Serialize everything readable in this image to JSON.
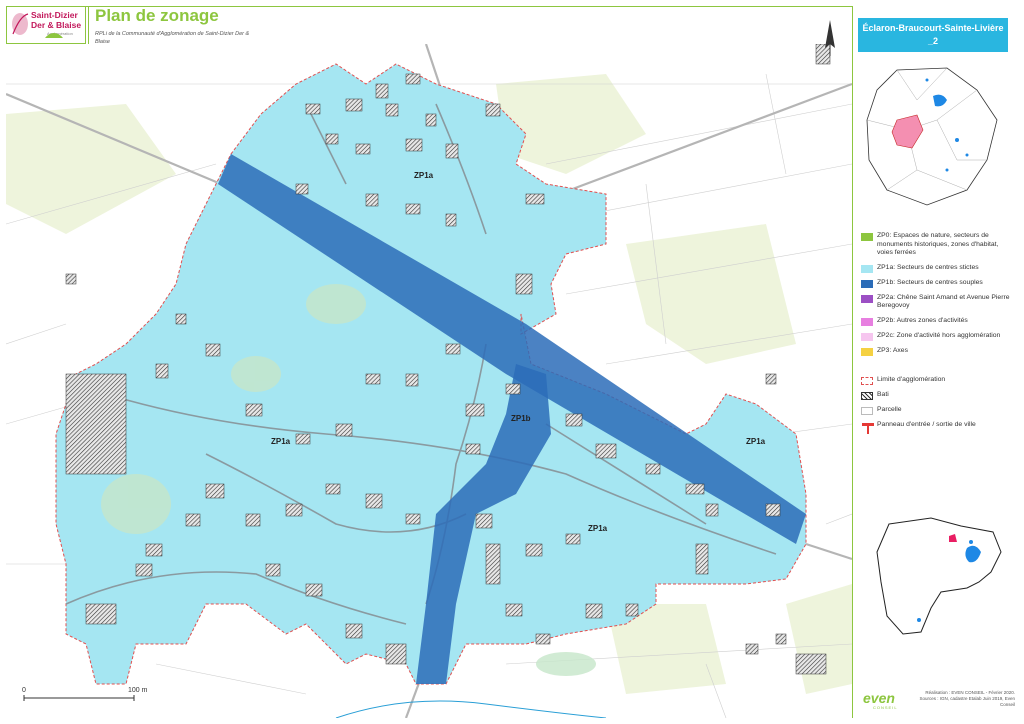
{
  "header": {
    "logo_line1": "Saint-Dizier",
    "logo_line2": "Der & Blaise",
    "logo_line3": "Agglomération",
    "title": "Plan de zonage",
    "subtitle": "RPLi de la Communauté d'Agglomération de Saint-Dizier Der & Blaise"
  },
  "commune": {
    "name": "Éclaron-Braucourt-Sainte-Livière _2"
  },
  "map": {
    "zone_labels": [
      "ZP1a",
      "ZP1a",
      "ZP1a",
      "ZP1a",
      "ZP1b"
    ],
    "scale_start": "0",
    "scale_end": "100 m"
  },
  "legend": {
    "items": [
      {
        "label": "ZP0: Espaces de nature, secteurs de monuments historiques, zones d'habitat, voies ferrées",
        "color": "#8dc63f"
      },
      {
        "label": "ZP1a: Secteurs de centres stictes",
        "color": "#a5e6f2"
      },
      {
        "label": "ZP1b: Secteurs de centres souples",
        "color": "#2b6cb8"
      },
      {
        "label": "ZP2a: Chêne Saint Amand et Avenue Pierre Beregovoy",
        "color": "#9c4fc4"
      },
      {
        "label": "ZP2b: Autres zones d'activités",
        "color": "#e77fe0"
      },
      {
        "label": "ZP2c: Zone d'activité hors agglomération",
        "color": "#f6c6ef"
      },
      {
        "label": "ZP3: Axes",
        "color": "#f5d142"
      }
    ],
    "symbols": [
      {
        "label": "Limite d'agglomération",
        "icon": "dashed-red-outline"
      },
      {
        "label": "Bati",
        "icon": "hatched-square"
      },
      {
        "label": "Parcelle",
        "icon": "grey-outline"
      },
      {
        "label": "Panneau d'entrée / sortie de ville",
        "icon": "red-sign"
      }
    ]
  },
  "credits": {
    "text": "Réalisation : EVEN CONSEIL - Février 2020. Sources : IGN, cadastre Etalab Juin 2019, Even Conseil",
    "brand": "even",
    "brand_sub": "CONSEIL"
  }
}
